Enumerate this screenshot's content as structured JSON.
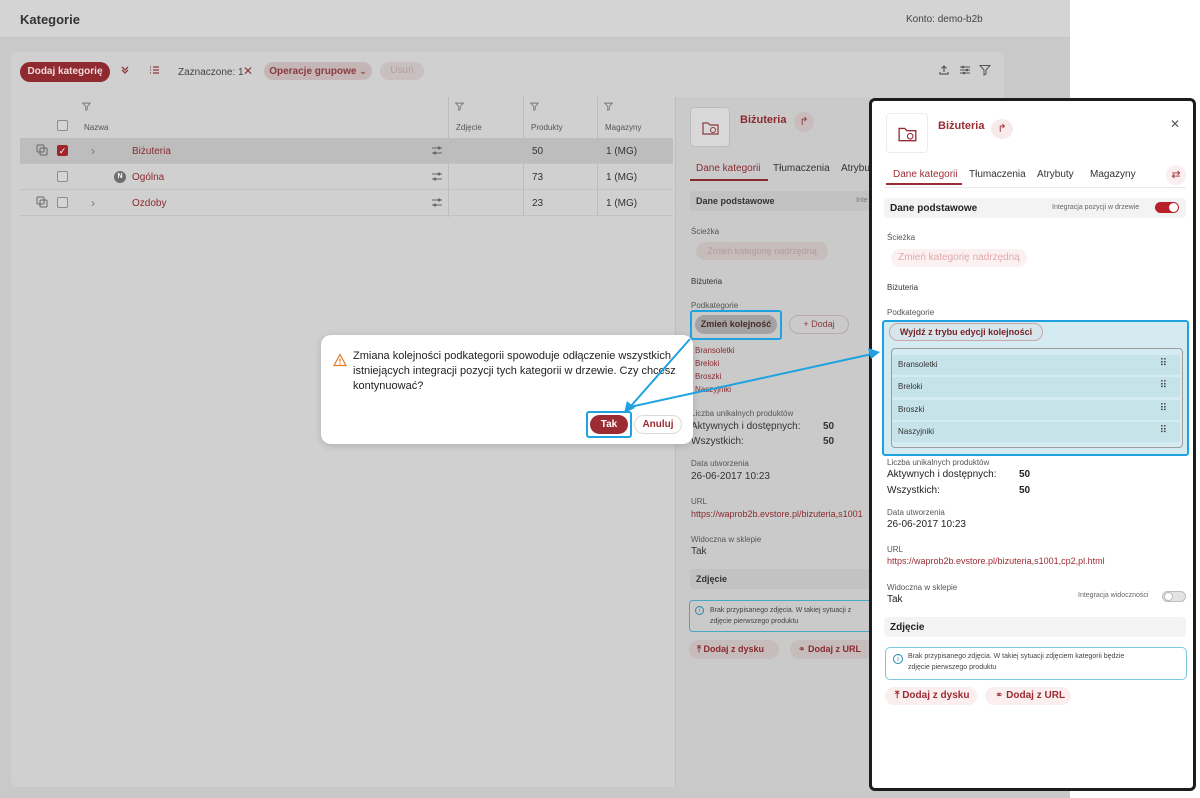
{
  "app": {
    "title": "Kategorie",
    "account": "Konto: demo-b2b"
  },
  "toolbar": {
    "add_category": "Dodaj kategorię",
    "selected": "Zaznaczone: 1",
    "clear_selection_icon": "close-icon",
    "group_ops": "Operacje grupowe",
    "delete": "Usuń",
    "icons": [
      "chevrons-down-icon",
      "list-icon",
      "upload-icon",
      "sliders-icon",
      "filter-icon"
    ]
  },
  "table": {
    "columns": {
      "name": "Nazwa",
      "photo": "Zdjęcie",
      "products": "Produkty",
      "warehouses": "Magazyny"
    },
    "rows": [
      {
        "name": "Biżuteria",
        "products": "50",
        "warehouses": "1 (MG)",
        "checked": true,
        "badge": ""
      },
      {
        "name": "Ogólna",
        "products": "73",
        "warehouses": "1 (MG)",
        "checked": false,
        "badge": "N"
      },
      {
        "name": "Ozdoby",
        "products": "23",
        "warehouses": "1 (MG)",
        "checked": false,
        "badge": ""
      }
    ]
  },
  "detail_bg": {
    "title": "Biżuteria",
    "tabs": [
      "Dane kategorii",
      "Tłumaczenia",
      "Atrybu"
    ],
    "section_basic": "Dane podstawowe",
    "section_hint": "Inte",
    "path_label": "Ścieżka",
    "change_parent": "Zmień kategorię nadrzędną",
    "path_value": "Biżuteria",
    "subcats_label": "Podkategorie",
    "change_order": "Zmień kolejność",
    "add": "Dodaj",
    "subcats": [
      "Bransoletki",
      "Breloki",
      "Broszki",
      "Naszyjniki"
    ],
    "unique_label": "Liczba unikalnych produktów",
    "active_label": "Aktywnych i dostępnych:",
    "active_value": "50",
    "all_label": "Wszystkich:",
    "all_value": "50",
    "created_label": "Data utworzenia",
    "created_value": "26-06-2017 10:23",
    "url_label": "URL",
    "url_value": "https://waprob2b.evstore.pl/bizuteria,s1001",
    "visible_label": "Widoczna w sklepie",
    "visible_value": "Tak",
    "photo_section": "Zdjęcie",
    "photo_info": "Brak przypisanego zdjęcia. W takiej sytuacji z zdjęcie pierwszego produktu",
    "add_from_disk": "Dodaj z dysku",
    "add_from_url": "Dodaj z URL"
  },
  "modal": {
    "message": "Zmiana kolejności podkategorii spowoduje odłączenie wszystkich istniejących integracji pozycji tych kategorii w drzewie. Czy chcesz kontynuować?",
    "yes": "Tak",
    "no": "Anuluj"
  },
  "panel": {
    "title": "Biżuteria",
    "tabs": [
      "Dane kategorii",
      "Tłumaczenia",
      "Atrybuty",
      "Magazyny"
    ],
    "section_basic": "Dane podstawowe",
    "integration_label": "Integracja pozycji w drzewie",
    "integration_on": true,
    "path_label": "Ścieżka",
    "change_parent": "Zmień kategorię nadrzędną",
    "path_value": "Biżuteria",
    "subcats_label": "Podkategorie",
    "exit_order": "Wyjdź z trybu edycji kolejności",
    "subcats": [
      "Bransoletki",
      "Breloki",
      "Broszki",
      "Naszyjniki"
    ],
    "unique_label": "Liczba unikalnych produktów",
    "active_label": "Aktywnych i dostępnych:",
    "active_value": "50",
    "all_label": "Wszystkich:",
    "all_value": "50",
    "created_label": "Data utworzenia",
    "created_value": "26-06-2017 10:23",
    "url_label": "URL",
    "url_value": "https://waprob2b.evstore.pl/bizuteria,s1001,cp2,pl.html",
    "visible_label": "Widoczna w sklepie",
    "visible_value": "Tak",
    "visibility_integration_label": "Integracja widoczności",
    "visibility_integration_on": false,
    "photo_section": "Zdjęcie",
    "photo_info_line1": "Brak przypisanego zdjęcia. W takiej sytuacji zdjęciem kategorii będzie",
    "photo_info_line2": "zdjęcie pierwszego produktu",
    "add_from_disk": "Dodaj z dysku",
    "add_from_url": "Dodaj z URL"
  },
  "colors": {
    "accent": "#9c2c34",
    "highlight": "#1ea3e0",
    "highlight_fill": "#c7e3ea"
  }
}
